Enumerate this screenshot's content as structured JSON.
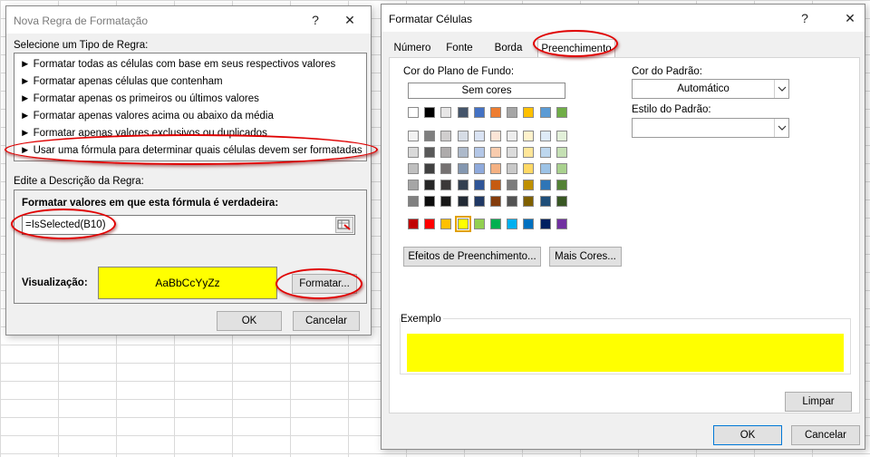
{
  "new_rule_dialog": {
    "title": "Nova Regra de Formatação",
    "help_label": "?",
    "close_label": "✕",
    "select_type_label": "Selecione um Tipo de Regra:",
    "rule_types": [
      "► Formatar todas as células com base em seus respectivos valores",
      "► Formatar apenas células que contenham",
      "► Formatar apenas os primeiros ou últimos valores",
      "► Formatar apenas valores acima ou abaixo da média",
      "► Formatar apenas valores exclusivos ou duplicados",
      "► Usar uma fórmula para determinar quais células devem ser formatadas"
    ],
    "edit_description_label": "Edite a Descrição da Regra:",
    "formula_label": "Formatar valores em que esta fórmula é verdadeira:",
    "formula_value": "=IsSelected(B10)",
    "preview_label": "Visualização:",
    "preview_text": "AaBbCcYyZz",
    "preview_color": "#ffff00",
    "format_button": "Formatar...",
    "ok_button": "OK",
    "cancel_button": "Cancelar"
  },
  "format_cells_dialog": {
    "title": "Formatar Células",
    "help_label": "?",
    "close_label": "✕",
    "tabs": [
      "Número",
      "Fonte",
      "Borda",
      "Preenchimento"
    ],
    "active_tab": "Preenchimento",
    "background_color_label": "Cor do Plano de Fundo:",
    "no_color_button": "Sem cores",
    "theme_colors_row1": [
      "#ffffff",
      "#000000",
      "#e7e6e6",
      "#44546a",
      "#4472c4",
      "#ed7d31",
      "#a5a5a5",
      "#ffc000",
      "#5b9bd5",
      "#70ad47"
    ],
    "theme_colors_tints": [
      [
        "#f2f2f2",
        "#7f7f7f",
        "#d0cece",
        "#d6dce5",
        "#dae3f3",
        "#fbe5d6",
        "#ededed",
        "#fff2cc",
        "#deebf7",
        "#e2f0d9"
      ],
      [
        "#d9d9d9",
        "#595959",
        "#aeabab",
        "#adb9ca",
        "#b4c7e7",
        "#f8cbad",
        "#dbdbdb",
        "#ffe699",
        "#bdd7ee",
        "#c5e0b4"
      ],
      [
        "#bfbfbf",
        "#404040",
        "#757171",
        "#8497b0",
        "#8faadc",
        "#f4b183",
        "#c9c9c9",
        "#ffd966",
        "#9dc3e6",
        "#a9d18e"
      ],
      [
        "#a6a6a6",
        "#262626",
        "#3b3838",
        "#333f50",
        "#2f5597",
        "#c55a11",
        "#7b7b7b",
        "#bf9000",
        "#2e75b6",
        "#538135"
      ],
      [
        "#808080",
        "#0d0d0d",
        "#171717",
        "#222a35",
        "#203864",
        "#843c0c",
        "#525252",
        "#7f6000",
        "#1f4e79",
        "#385723"
      ]
    ],
    "standard_colors": [
      "#c00000",
      "#ff0000",
      "#ffc000",
      "#ffff00",
      "#92d050",
      "#00b050",
      "#00b0f0",
      "#0070c0",
      "#002060",
      "#7030a0"
    ],
    "selected_standard_index": 3,
    "fill_effects_button": "Efeitos de Preenchimento...",
    "more_colors_button": "Mais Cores...",
    "pattern_color_label": "Cor do Padrão:",
    "pattern_color_value": "Automático",
    "pattern_style_label": "Estilo do Padrão:",
    "pattern_style_value": "",
    "sample_label": "Exemplo",
    "sample_color": "#ffff00",
    "clear_button": "Limpar",
    "ok_button": "OK",
    "cancel_button": "Cancelar"
  }
}
